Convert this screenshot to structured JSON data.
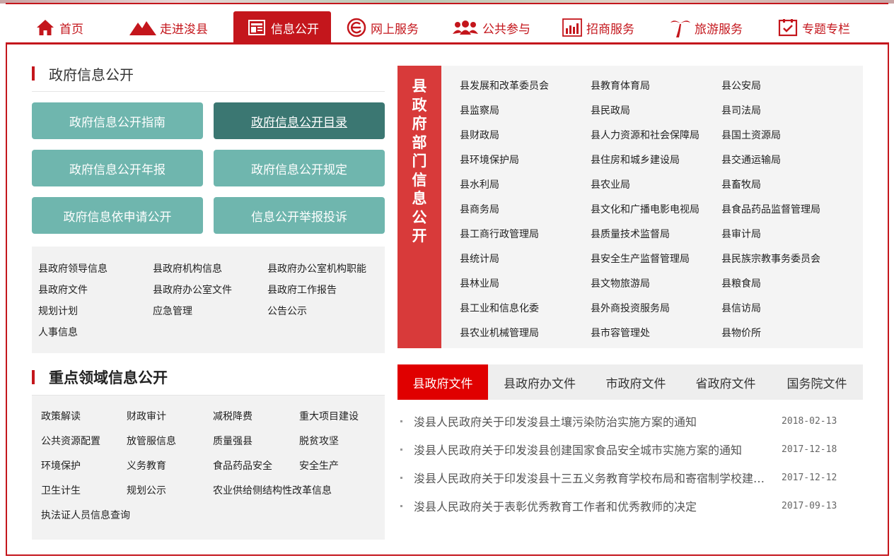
{
  "nav": {
    "items": [
      {
        "label": "首页",
        "icon": "home-icon"
      },
      {
        "label": "走进浚县",
        "icon": "mountain-icon"
      },
      {
        "label": "信息公开",
        "icon": "newspaper-icon"
      },
      {
        "label": "网上服务",
        "icon": "e-service-icon"
      },
      {
        "label": "公共参与",
        "icon": "people-icon"
      },
      {
        "label": "招商服务",
        "icon": "chart-icon"
      },
      {
        "label": "旅游服务",
        "icon": "palm-tree-icon"
      },
      {
        "label": "专题专栏",
        "icon": "checkbox-icon"
      }
    ],
    "active_index": 2,
    "accent": "#c4161c"
  },
  "gov_info": {
    "title": "政府信息公开",
    "tiles": [
      "政府信息公开指南",
      "政府信息公开目录",
      "政府信息公开年报",
      "政府信息公开规定",
      "政府信息依申请公开",
      "信息公开举报投诉"
    ],
    "links": [
      "县政府领导信息",
      "县政府机构信息",
      "县政府办公室机构职能",
      "县政府文件",
      "县政府办公室文件",
      "县政府工作报告",
      "规划计划",
      "应急管理",
      "公告公示",
      "人事信息"
    ]
  },
  "key_areas": {
    "title": "重点领域信息公开",
    "links": [
      "政策解读",
      "财政审计",
      "减税降费",
      "重大项目建设",
      "公共资源配置",
      "放管服信息",
      "质量强县",
      "脱贫攻坚",
      "环境保护",
      "义务教育",
      "食品药品安全",
      "安全生产",
      "卫生计生",
      "规划公示",
      "农业供给侧结构性改革信息",
      "执法证人员信息查询"
    ]
  },
  "departments": {
    "title_chars": [
      "县",
      "政",
      "府",
      "部",
      "门",
      "信",
      "息",
      "公",
      "开"
    ],
    "items": [
      "县发展和改革委员会",
      "县教育体育局",
      "县公安局",
      "县监察局",
      "县民政局",
      "县司法局",
      "县财政局",
      "县人力资源和社会保障局",
      "县国土资源局",
      "县环境保护局",
      "县住房和城乡建设局",
      "县交通运输局",
      "县水利局",
      "县农业局",
      "县畜牧局",
      "县商务局",
      "县文化和广播电影电视局",
      "县食品药品监督管理局",
      "县工商行政管理局",
      "县质量技术监督局",
      "县审计局",
      "县统计局",
      "县安全生产监督管理局",
      "县民族宗教事务委员会",
      "县林业局",
      "县文物旅游局",
      "县粮食局",
      "县工业和信息化委",
      "县外商投资服务局",
      "县信访局",
      "县农业机械管理局",
      "县市容管理处",
      "县物价所"
    ]
  },
  "docs": {
    "tabs": [
      "县政府文件",
      "县政府办文件",
      "市政府文件",
      "省政府文件",
      "国务院文件"
    ],
    "active_index": 0,
    "news": [
      {
        "title": "浚县人民政府关于印发浚县土壤污染防治实施方案的通知",
        "date": "2018-02-13"
      },
      {
        "title": "浚县人民政府关于印发浚县创建国家食品安全城市实施方案的通知",
        "date": "2017-12-18"
      },
      {
        "title": "浚县人民政府关于印发浚县十三五义务教育学校布局和寄宿制学校建设规划的通知",
        "date": "2017-12-12"
      },
      {
        "title": "浚县人民政府关于表彰优秀教育工作者和优秀教师的决定",
        "date": "2017-09-13"
      }
    ]
  }
}
